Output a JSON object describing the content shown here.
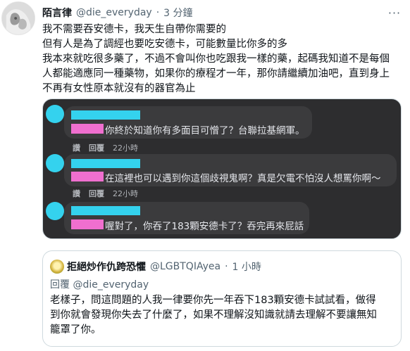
{
  "tweet": {
    "author_name": "陌言律",
    "author_handle": "@die_everyday",
    "separator": "·",
    "time": "3 分鐘",
    "more": "···",
    "lines": [
      "我不需要吞安德卡，我天生自帶你需要的",
      "但有人是為了調經也要吃安德卡，可能數量比你多的多",
      "我本來就吃很多藥了，不過不會叫你也吃跟我一樣的藥，起碼我知道不是每個",
      "人都能適應同一種藥物，如果你的療程才一年，那你請繼續加油吧，直到身上",
      "不再有女性原本就沒有的器官為止"
    ]
  },
  "screenshot": {
    "comments": [
      {
        "text": "你終於知道你有多面目可憎了？台聯拉基網軍。",
        "actions": [
          "讚",
          "回覆",
          "22小時"
        ]
      },
      {
        "text": "在這裡也可以遇到你這個歧視鬼啊？真是欠電不怕沒人想罵你啊～",
        "actions": [
          "讚",
          "回覆",
          "22小時"
        ]
      },
      {
        "text": "喔對了，你吞了183顆安德卡了？吞完再來屁話",
        "actions": []
      }
    ]
  },
  "quote": {
    "author_name": "拒絕炒作仇跨恐懼",
    "author_handle": "@LGBTQIAyea",
    "separator": "·",
    "time": "1 小時",
    "reply_prefix": "回覆",
    "reply_handle": "@die_everyday",
    "lines": [
      "老樣子，問這問題的人我一律要你先一年吞下183顆安德卡試試看，做得",
      "到你就會發現你失去了什麼了，如果不理解沒知識就請去理解不要讓無知",
      "籠罩了你。"
    ]
  },
  "colors": {
    "cyan_redaction": "#34d2ee",
    "pink_redaction": "#f06fcf",
    "dark_bg": "#2d2d2f",
    "bubble": "#3b3b3d"
  }
}
